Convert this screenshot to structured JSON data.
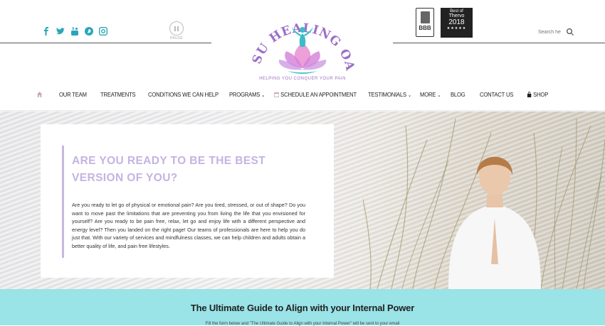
{
  "social": [
    {
      "icon": "facebook-icon"
    },
    {
      "icon": "twitter-icon"
    },
    {
      "icon": "youtube-icon"
    },
    {
      "icon": "pinterest-icon"
    },
    {
      "icon": "instagram-icon"
    }
  ],
  "slider": {
    "pause_label": "PAUSE"
  },
  "logo": {
    "name": "MINSU HEALING OASIS",
    "tagline": "HELPING YOU CONQUER YOUR PAIN"
  },
  "badges": {
    "bbb": "BBB",
    "thervo_line1": "Best of",
    "thervo_line2": "Thervo",
    "thervo_year": "2018",
    "thervo_stars": "★★★★★"
  },
  "search": {
    "placeholder": "Search he"
  },
  "nav": {
    "home": "home-icon",
    "items": [
      "OUR TEAM",
      "TREATMENTS",
      "CONDITIONS WE CAN HELP",
      "PROGRAMS",
      "SCHEDULE AN APPOINTMENT",
      "TESTIMONIALS",
      "MORE",
      "BLOG",
      "CONTACT US",
      "SHOP"
    ]
  },
  "hero": {
    "heading": "ARE YOU READY TO BE THE BEST VERSION OF YOU?",
    "body": "Are you ready to let go of physical or emotional pain? Are you tired, stressed, or out of shape? Do you want to move past the limitations that are preventing you from living the life that you envisioned for yourself? Are you ready to be pain free, relax, let go and enjoy life with a different perspective and energy level? Then you landed on the right page! Our teams of professionals are here to help you do just that. With our variety of services and mindfulness classes, we can help children and adults obtain a better quality of life, and pain free lifestyles."
  },
  "band": {
    "title": "The Ultimate Guide to Align with your Internal Power",
    "subtitle": "Fill the form below and \"The Ultimate Guide to Align with your Internal Power\" will be sent to your email"
  },
  "colors": {
    "accent_teal": "#2aa6b8",
    "lavender": "#c5b3e2",
    "band": "#9ae3e7"
  }
}
